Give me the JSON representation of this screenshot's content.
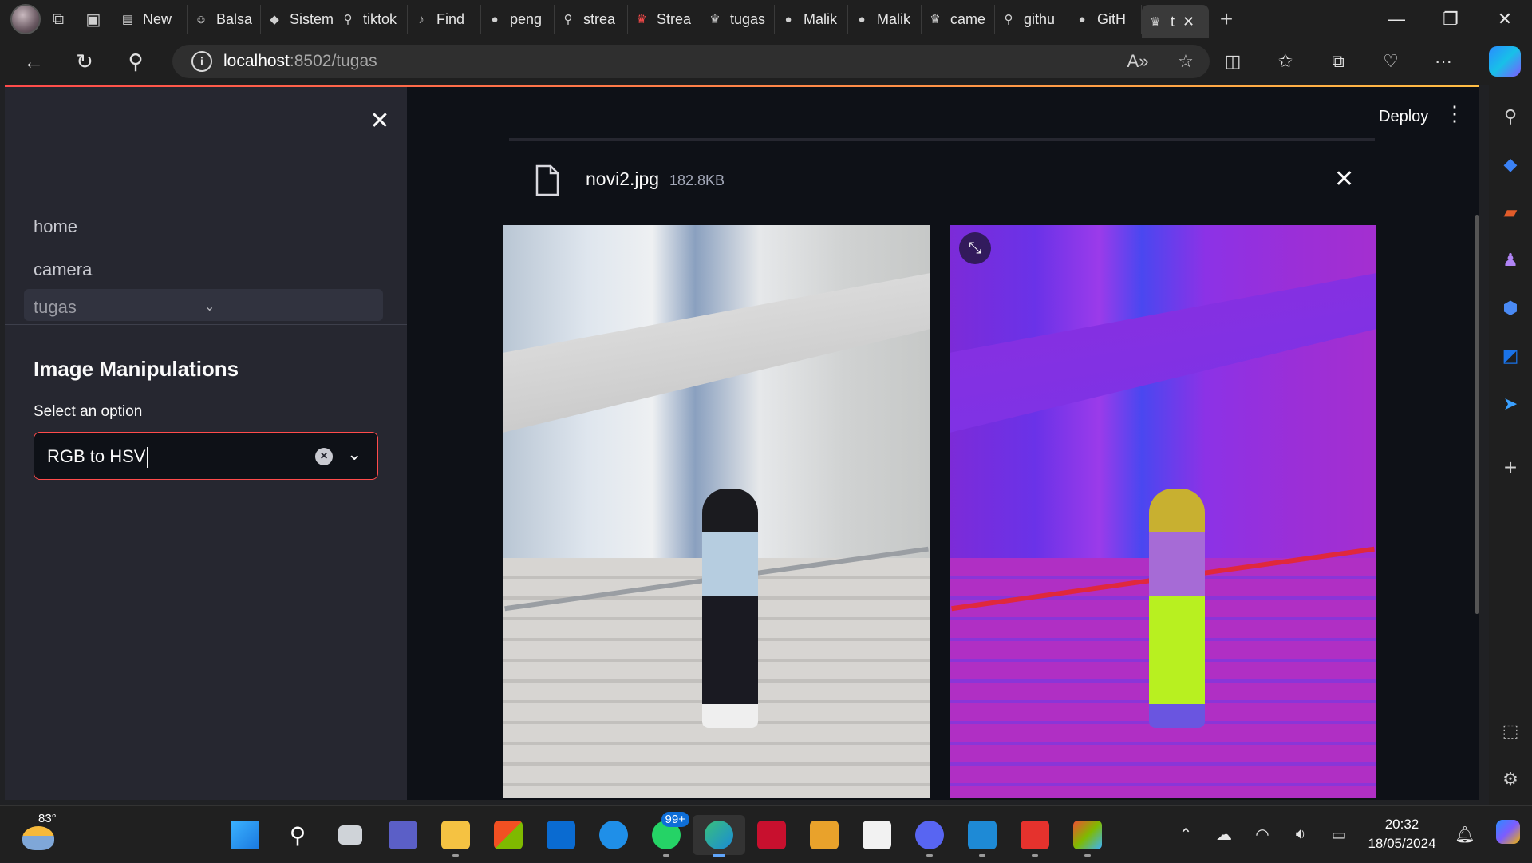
{
  "browser": {
    "tabs": [
      {
        "label": "New",
        "icon": "new-tab-icon"
      },
      {
        "label": "Balsa",
        "icon": "chat-icon"
      },
      {
        "label": "Sistem",
        "icon": "app-icon"
      },
      {
        "label": "tiktok",
        "icon": "search-icon"
      },
      {
        "label": "Find",
        "icon": "tiktok-icon"
      },
      {
        "label": "peng",
        "icon": "github-icon"
      },
      {
        "label": "strea",
        "icon": "search-icon"
      },
      {
        "label": "Strea",
        "icon": "streamlit-icon"
      },
      {
        "label": "tugas",
        "icon": "streamlit-icon"
      },
      {
        "label": "Malik",
        "icon": "github-icon"
      },
      {
        "label": "Malik",
        "icon": "github-icon"
      },
      {
        "label": "came",
        "icon": "streamlit-icon"
      },
      {
        "label": "githu",
        "icon": "search-icon"
      },
      {
        "label": "GitH",
        "icon": "github-icon"
      },
      {
        "label": "t",
        "icon": "streamlit-icon"
      }
    ],
    "url_host": "localhost",
    "url_path": ":8502/tugas"
  },
  "sidebar": {
    "nav": [
      {
        "label": "home"
      },
      {
        "label": "camera"
      },
      {
        "label": "tugas"
      }
    ],
    "header": "Image Manipulations",
    "select_label": "Select an option",
    "select_value": "RGB to HSV"
  },
  "main": {
    "deploy_label": "Deploy",
    "file_name": "novi2.jpg",
    "file_size": "182.8KB"
  },
  "taskbar": {
    "weather_temp": "83°",
    "whatsapp_badge": "99+",
    "time": "20:32",
    "date": "18/05/2024"
  },
  "colors": {
    "accent": "#ff4b4b",
    "app_bg": "#0e1117",
    "sidebar_bg": "#262730"
  }
}
